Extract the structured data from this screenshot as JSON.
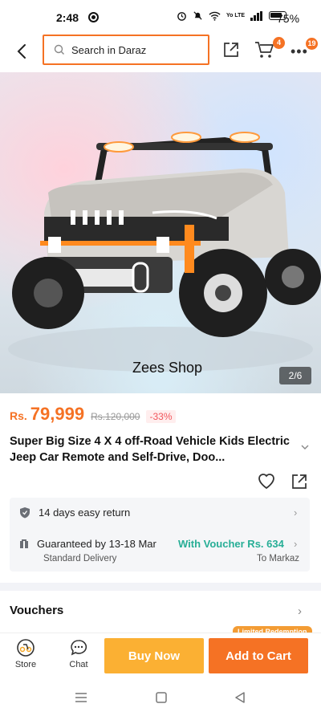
{
  "status_bar": {
    "time": "2:48",
    "battery": "75%",
    "net": "Yo LTE"
  },
  "header": {
    "search_placeholder": "Search in Daraz",
    "cart_count": "4",
    "more_count": "19"
  },
  "gallery": {
    "watermark": "Zees Shop",
    "counter": "2/6"
  },
  "product": {
    "currency": "Rs.",
    "price": "79,999",
    "original_price": "Rs.120,000",
    "discount": "-33%",
    "title": "Super Big Size 4 X 4 off-Road Vehicle Kids Electric Jeep Car Remote and Self-Drive, Doo..."
  },
  "service": {
    "return_text": "14 days easy return",
    "guarantee_text": "Guaranteed by 13-18 Mar",
    "voucher_text": "With Voucher Rs. 634",
    "delivery_type": "Standard Delivery",
    "delivery_to": "To Markaz"
  },
  "vouchers": {
    "heading": "Vouchers",
    "badge": "Limited Redemption"
  },
  "bottom_bar": {
    "store_label": "Store",
    "chat_label": "Chat",
    "buy_now_label": "Buy Now",
    "add_to_cart_label": "Add to Cart"
  },
  "colors": {
    "accent": "#f57224",
    "buy_now": "#fbb033",
    "voucher_green": "#27ae96"
  }
}
